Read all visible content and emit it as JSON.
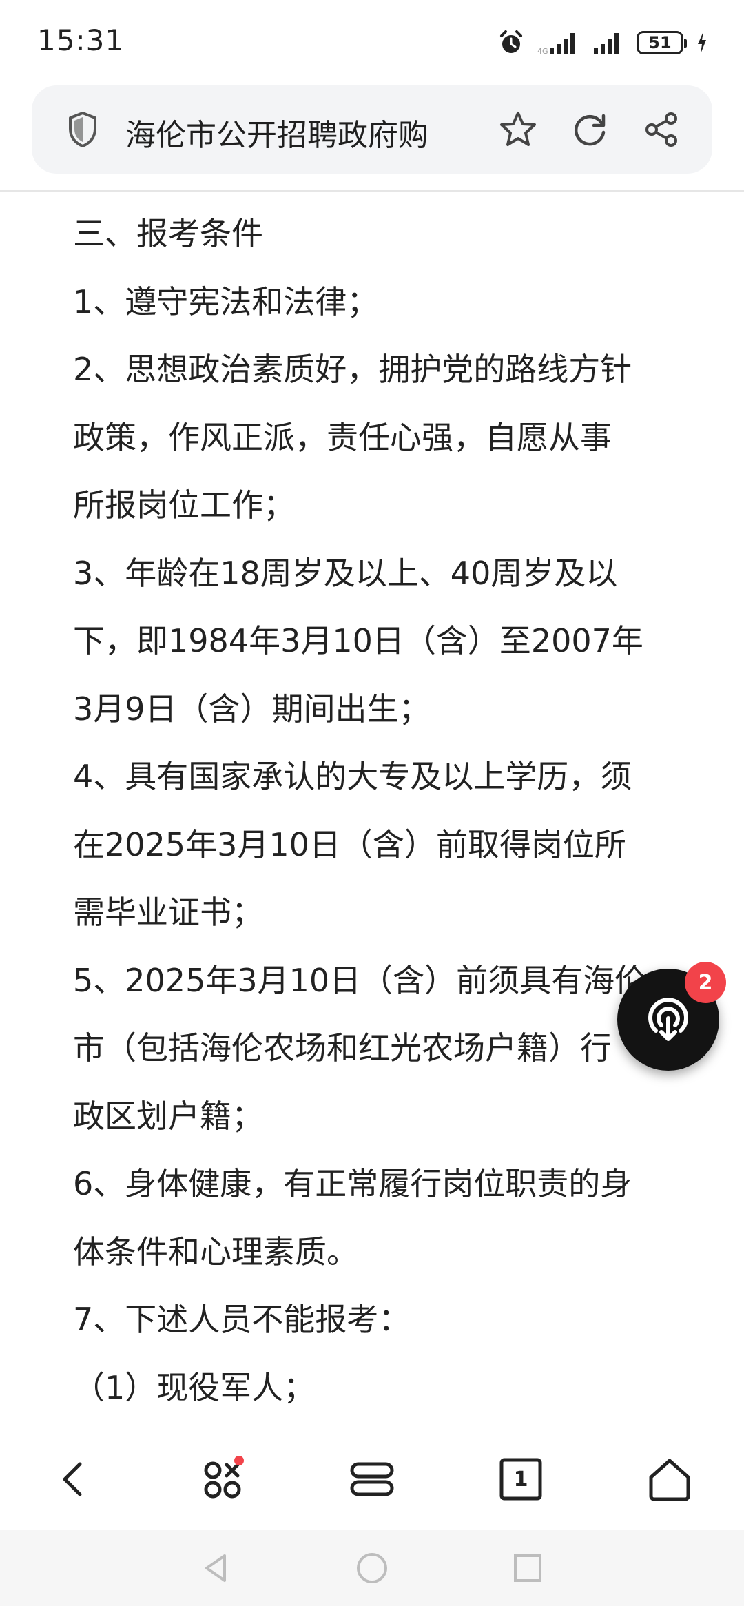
{
  "status_bar": {
    "time": "15:31",
    "battery_level": "51",
    "icons": [
      "alarm-icon",
      "signal-1-icon",
      "signal-2-icon",
      "battery-icon",
      "charging-icon"
    ]
  },
  "address_bar": {
    "title": "海伦市公开招聘政府购",
    "icons": [
      "shield-icon",
      "star-icon",
      "refresh-icon",
      "share-icon"
    ]
  },
  "article": {
    "lines": [
      "三、报考条件",
      "1、遵守宪法和法律；",
      "2、思想政治素质好，拥护党的路线方针",
      "政策，作风正派，责任心强，自愿从事",
      "所报岗位工作；",
      "3、年龄在18周岁及以上、40周岁及以",
      "下，即1984年3月10日（含）至2007年",
      "3月9日（含）期间出生；",
      "4、具有国家承认的大专及以上学历，须",
      "在2025年3月10日（含）前取得岗位所",
      "需毕业证书；",
      "5、2025年3月10日（含）前须具有海伦",
      "市（包括海伦农场和红光农场户籍）行",
      "政区划户籍；",
      "6、身体健康，有正常履行岗位职责的身",
      "体条件和心理素质。",
      "7、下述人员不能报考：",
      "（1）现役军人；"
    ]
  },
  "floating_button": {
    "badge": "2",
    "icon": "podcast-icon"
  },
  "toolbar": {
    "tabs_count": "1",
    "icons": [
      "back-icon",
      "apps-icon",
      "menu-icon",
      "tabs-icon",
      "home-icon"
    ],
    "apps_dot_color": "#f2434a"
  },
  "system_nav": {
    "icons": [
      "nav-back-icon",
      "nav-home-icon",
      "nav-recents-icon"
    ]
  }
}
